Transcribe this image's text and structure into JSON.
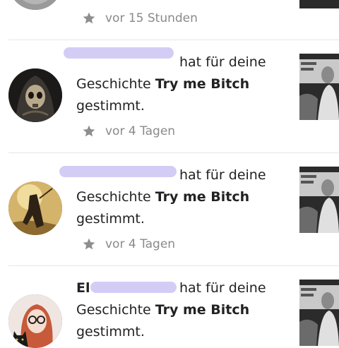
{
  "notifications": [
    {
      "time": "vor 15 Stunden"
    },
    {
      "username_visible": "",
      "action_text": "hat für deine",
      "line2_prefix": "Geschichte ",
      "story_title": "Try me Bitch",
      "line3": "gestimmt.",
      "time": "vor 4 Tagen",
      "avatar_icon": "skull-avatar"
    },
    {
      "username_visible": "",
      "action_text": "hat für deine",
      "line2_prefix": "Geschichte ",
      "story_title": "Try me Bitch",
      "line3": "gestimmt.",
      "time": "vor 4 Tagen",
      "avatar_icon": "warrior-avatar"
    },
    {
      "username_visible": "El",
      "action_text": "hat für deine",
      "line2_prefix": "Geschichte ",
      "story_title": "Try me Bitch",
      "line3": "gestimmt.",
      "avatar_icon": "girl-with-cat-avatar"
    }
  ],
  "icons": {
    "vote": "star-icon"
  },
  "colors": {
    "meta_text": "#8a8a8a",
    "star": "#8e8e8e",
    "redaction": "#d3cdf5",
    "divider": "#e6e6e6"
  }
}
